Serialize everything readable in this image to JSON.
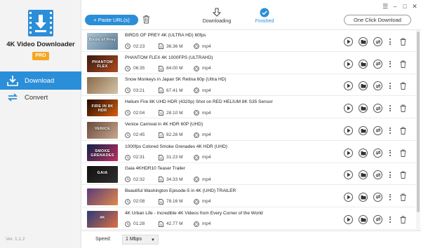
{
  "app": {
    "name": "4K Video Downloader",
    "pro_badge": "PRO",
    "version": "Ver. 1.1.2",
    "brand_color": "#2b8ed8"
  },
  "sidebar": {
    "items": [
      {
        "label": "Download",
        "icon": "download-icon",
        "active": true
      },
      {
        "label": "Convert",
        "icon": "convert-icon",
        "active": false
      }
    ]
  },
  "toolbar": {
    "paste_label": "+ Paste URL(s)",
    "one_click_label": "One Click Download",
    "tabs": [
      {
        "label": "Downloading",
        "icon": "download-arrow-icon",
        "active": false
      },
      {
        "label": "Finished",
        "icon": "check-circle-icon",
        "active": true
      }
    ],
    "window_controls": [
      "hamburger-icon",
      "minimize-icon",
      "maximize-icon",
      "close-icon"
    ]
  },
  "videos": [
    {
      "title": "BIRDS OF PREY 4K (ULTRA HD) 60fps",
      "duration": "02:23",
      "size": "36.36 M",
      "format": "mp4",
      "thumb_text": "Birds of Prey",
      "thumb_colors": [
        "#a8c2d6",
        "#5e7f95"
      ]
    },
    {
      "title": "PHANTOM FLEX 4K 1000FPS (ULTRAHD)",
      "duration": "06:35",
      "size": "84.00 M",
      "format": "mp4",
      "thumb_text": "PHANTOM FLEX",
      "thumb_colors": [
        "#3a1a10",
        "#b04a20"
      ]
    },
    {
      "title": "Snow Monkeys in Japan 5K Retina 60p (Ultra HD)",
      "duration": "03:21",
      "size": "67.41 M",
      "format": "mp4",
      "thumb_text": "",
      "thumb_colors": [
        "#8a6a4a",
        "#d4c4a8"
      ]
    },
    {
      "title": "Helium Fire 8K UHD HDR (4320p) Shot on RED HELIUM 8K S35 Sensor",
      "duration": "02:04",
      "size": "28.10 M",
      "format": "mp4",
      "thumb_text": "FIRE IN 8K HDR",
      "thumb_colors": [
        "#200800",
        "#d86010"
      ]
    },
    {
      "title": "Venice Carnival in 4K HDR 60P (UHD)",
      "duration": "02:45",
      "size": "82.28 M",
      "format": "mp4",
      "thumb_text": "VENICE",
      "thumb_colors": [
        "#6a4a3a",
        "#c8a890"
      ]
    },
    {
      "title": "1000fps Colored Smoke Grenades 4K HDR (UHD)",
      "duration": "02:31",
      "size": "31.23 M",
      "format": "mp4",
      "thumb_text": "SMOKE GRENADES",
      "thumb_colors": [
        "#10204a",
        "#c03060"
      ]
    },
    {
      "title": "Gaia 4KHDR10 Teaser Trailer",
      "duration": "02:32",
      "size": "34.33 M",
      "format": "mp4",
      "thumb_text": "GAIA",
      "thumb_colors": [
        "#101010",
        "#303030"
      ]
    },
    {
      "title": "Beautiful Washington Episode-5 in 4K (UHD) TRAILER",
      "duration": "02:08",
      "size": "78.16 M",
      "format": "mp4",
      "thumb_text": "",
      "thumb_colors": [
        "#5a3a7a",
        "#e08a4a"
      ]
    },
    {
      "title": "4K Urban Life - Incredible 4K Videos from Every Corner of the World",
      "duration": "01:28",
      "size": "42.77 M",
      "format": "mp4",
      "thumb_text": "4K",
      "thumb_colors": [
        "#2a3a7a",
        "#e07040"
      ]
    }
  ],
  "bottom": {
    "speed_label": "Speed:",
    "speed_value": "1 Mbps"
  }
}
